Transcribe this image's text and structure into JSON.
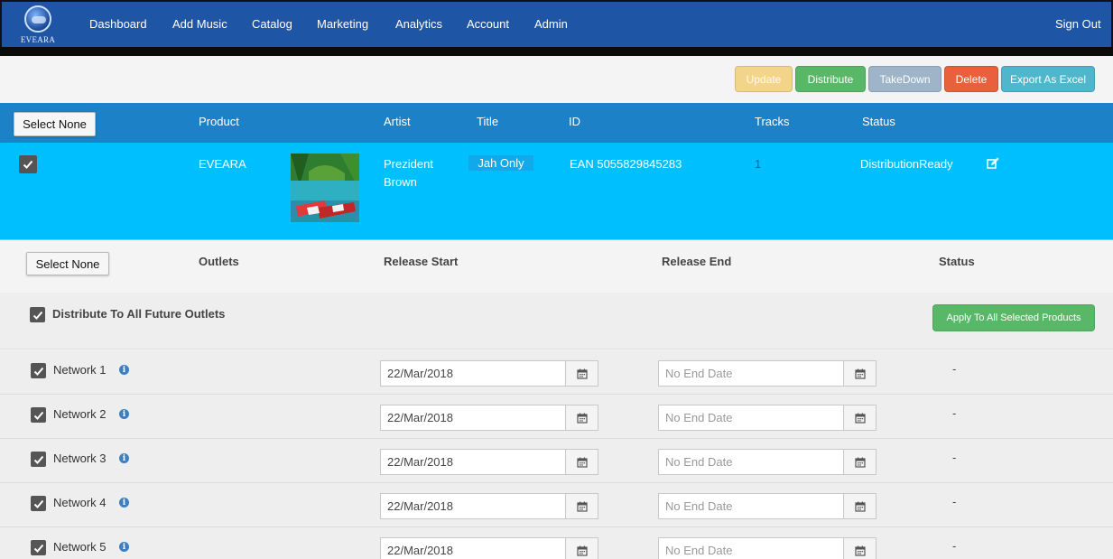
{
  "brand": {
    "logo_text": "EVEARA"
  },
  "nav": {
    "items": [
      "Dashboard",
      "Add Music",
      "Catalog",
      "Marketing",
      "Analytics",
      "Account",
      "Admin"
    ],
    "sign_out": "Sign Out"
  },
  "toolbar": {
    "update": "Update",
    "distribute": "Distribute",
    "takedown": "TakeDown",
    "delete": "Delete",
    "export": "Export As Excel"
  },
  "products_table": {
    "select_none": "Select None",
    "headers": {
      "product": "Product",
      "artist": "Artist",
      "title": "Title",
      "id": "ID",
      "tracks": "Tracks",
      "status": "Status"
    },
    "rows": [
      {
        "checked": true,
        "product": "EVEARA",
        "artist_line1": "Prezident",
        "artist_line2": "Brown",
        "title": "Jah Only",
        "id": "EAN 5055829845283",
        "tracks": "1",
        "status": "DistributionReady"
      }
    ]
  },
  "outlets_table": {
    "select_none": "Select None",
    "headers": {
      "outlets": "Outlets",
      "release_start": "Release Start",
      "release_end": "Release End",
      "status": "Status"
    },
    "future": {
      "label": "Distribute To All Future Outlets",
      "checked": true
    },
    "apply_button": "Apply To All Selected Products",
    "end_placeholder": "No End Date",
    "rows": [
      {
        "name": "Network 1",
        "start": "22/Mar/2018",
        "status": "-"
      },
      {
        "name": "Network 2",
        "start": "22/Mar/2018",
        "status": "-"
      },
      {
        "name": "Network 3",
        "start": "22/Mar/2018",
        "status": "-"
      },
      {
        "name": "Network 4",
        "start": "22/Mar/2018",
        "status": "-"
      },
      {
        "name": "Network 5",
        "start": "22/Mar/2018",
        "status": "-"
      }
    ]
  },
  "icons": {
    "checkbox": "check-icon",
    "info": "info-icon",
    "calendar": "calendar-icon",
    "edit": "edit-icon"
  },
  "colors": {
    "nav_bg": "#1f55a5",
    "header_bg": "#1c81c7",
    "row_selected": "#00bfff",
    "green": "#58b867",
    "red": "#e8603c",
    "teal": "#4fb6cc"
  }
}
